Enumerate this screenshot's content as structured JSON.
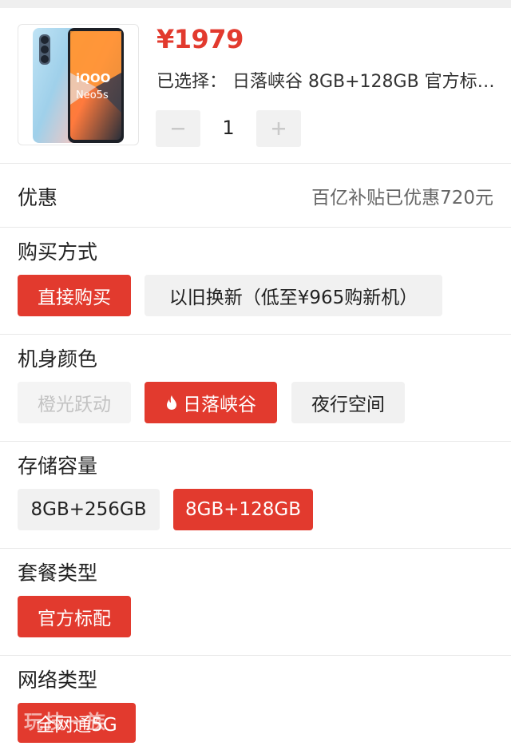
{
  "product": {
    "price": "¥1979",
    "selected_text": "已选择：  日落峡谷 8GB+128GB 官方标…",
    "quantity": "1",
    "image_text": "iQOO Neo5s"
  },
  "discount": {
    "label": "优惠",
    "value": "百亿补贴已优惠720元"
  },
  "purchase_method": {
    "label": "购买方式",
    "options": [
      "直接购买",
      "以旧换新（低至¥965购新机）"
    ]
  },
  "color": {
    "label": "机身颜色",
    "options": [
      "橙光跃动",
      "日落峡谷",
      "夜行空间"
    ]
  },
  "storage": {
    "label": "存储容量",
    "options": [
      "8GB+256GB",
      "8GB+128GB"
    ]
  },
  "package": {
    "label": "套餐类型",
    "options": [
      "官方标配"
    ]
  },
  "network": {
    "label": "网络类型",
    "options": [
      "全网通5G"
    ]
  },
  "watermark": "玩技一族",
  "colors": {
    "accent": "#e23a2e",
    "chip_bg": "#f1f1f1"
  }
}
